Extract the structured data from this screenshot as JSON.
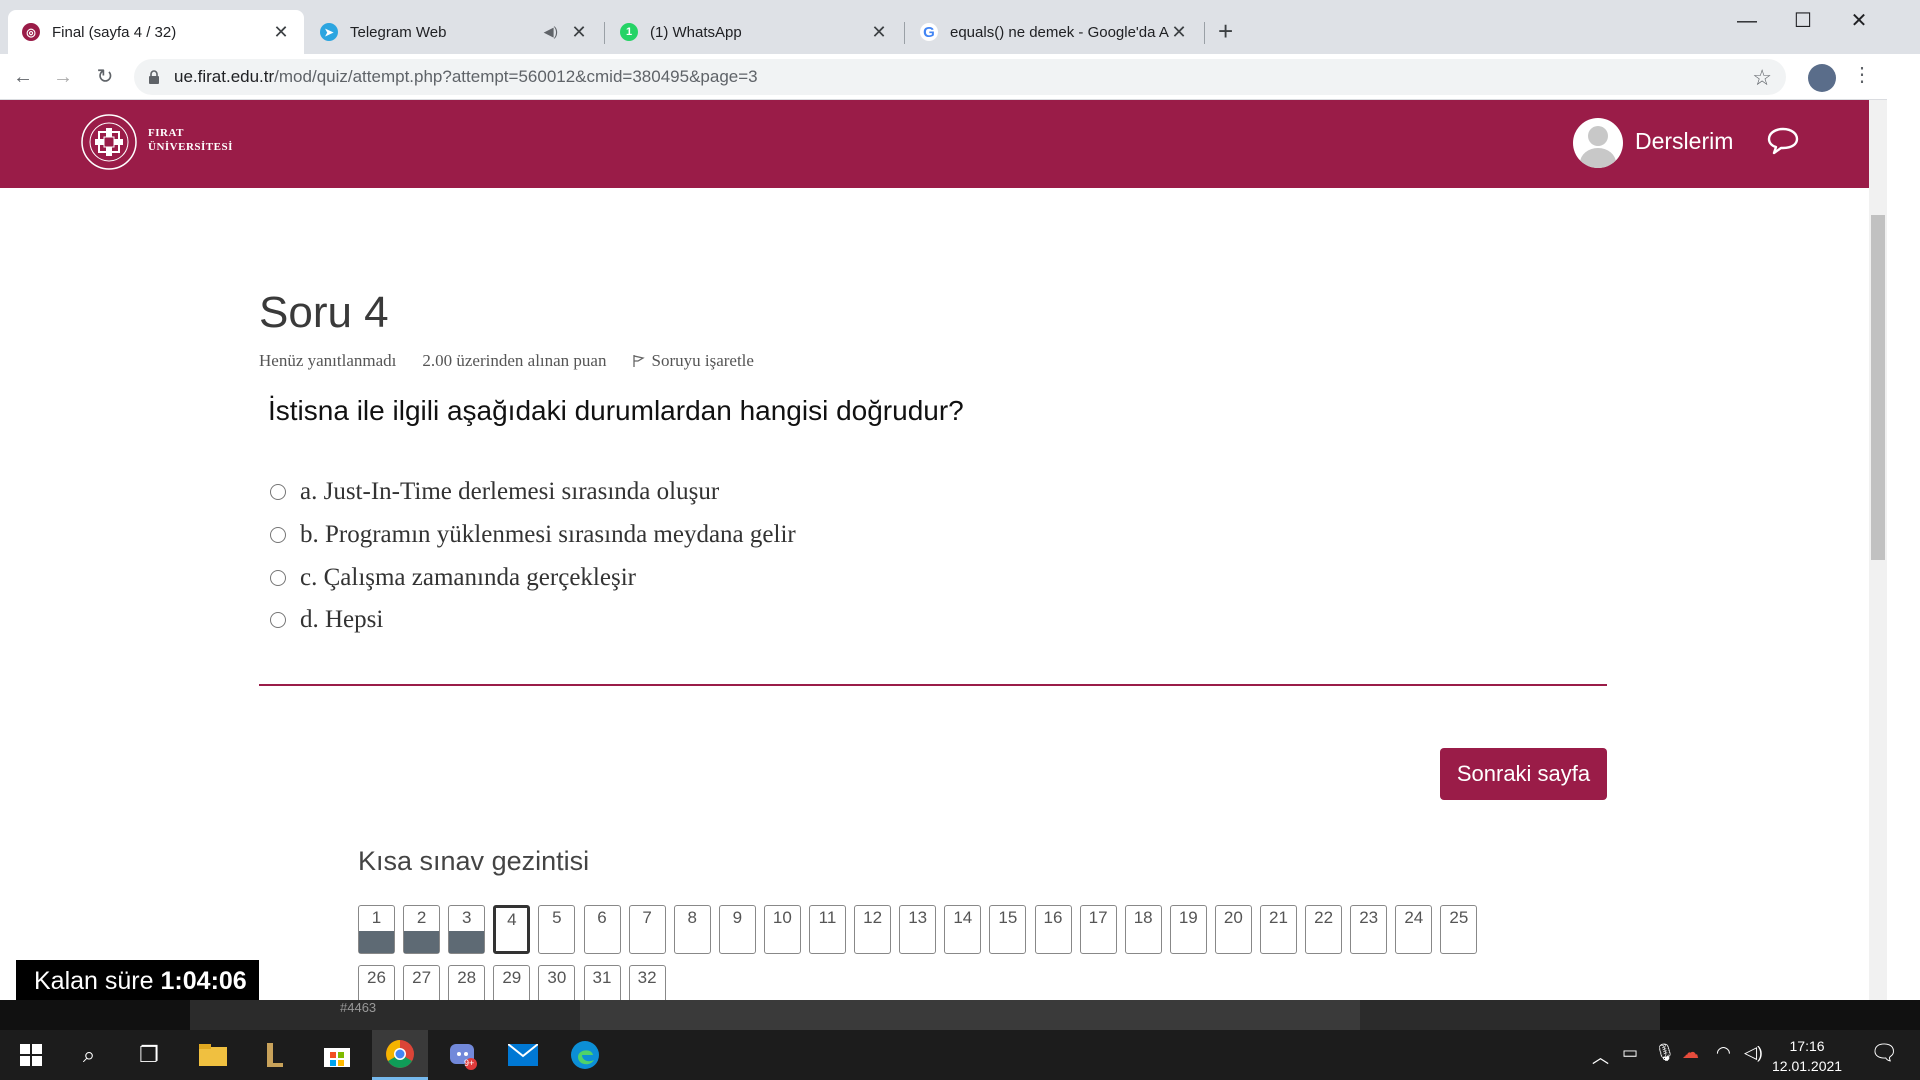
{
  "browser": {
    "tabs": [
      {
        "title": "Final (sayfa 4 / 32)",
        "active": true
      },
      {
        "title": "Telegram Web",
        "active": false
      },
      {
        "title": "(1) WhatsApp",
        "active": false
      },
      {
        "title": "equals() ne demek - Google'da A",
        "active": false
      }
    ],
    "new_tab": "+",
    "url_host": "ue.firat.edu.tr",
    "url_path": "/mod/quiz/attempt.php?attempt=560012&cmid=380495&page=3"
  },
  "site": {
    "logo_line1": "FIRAT",
    "logo_line2": "ÜNİVERSİTESİ",
    "courses_label": "Derslerim"
  },
  "question": {
    "title": "Soru 4",
    "status": "Henüz yanıtlanmadı",
    "points": "2.00 üzerinden alınan puan",
    "flag_label": "Soruyu işaretle",
    "text": "İstisna ile ilgili aşağıdaki durumlardan hangisi doğrudur?",
    "options": [
      "a. Just-In-Time derlemesi sırasında oluşur",
      "b. Programın yüklenmesi sırasında meydana gelir",
      "c. Çalışma zamanında gerçekleşir",
      "d. Hepsi"
    ]
  },
  "next_button": "Sonraki sayfa",
  "quiz_nav": {
    "title": "Kısa sınav gezintisi",
    "questions": [
      "1",
      "2",
      "3",
      "4",
      "5",
      "6",
      "7",
      "8",
      "9",
      "10",
      "11",
      "12",
      "13",
      "14",
      "15",
      "16",
      "17",
      "18",
      "19",
      "20",
      "21",
      "22",
      "23",
      "24",
      "25",
      "26",
      "27",
      "28",
      "29",
      "30",
      "31",
      "32"
    ],
    "answered": [
      "1",
      "2",
      "3"
    ],
    "current": "4"
  },
  "timer": {
    "label": "Kalan süre",
    "value": "1:04:06"
  },
  "taskbar": {
    "strip_text": "#4463",
    "time": "17:16",
    "date": "12.01.2021",
    "badge": "9+"
  },
  "colors": {
    "brand": "#9a1c48",
    "answered_fill": "#5e6a74"
  }
}
